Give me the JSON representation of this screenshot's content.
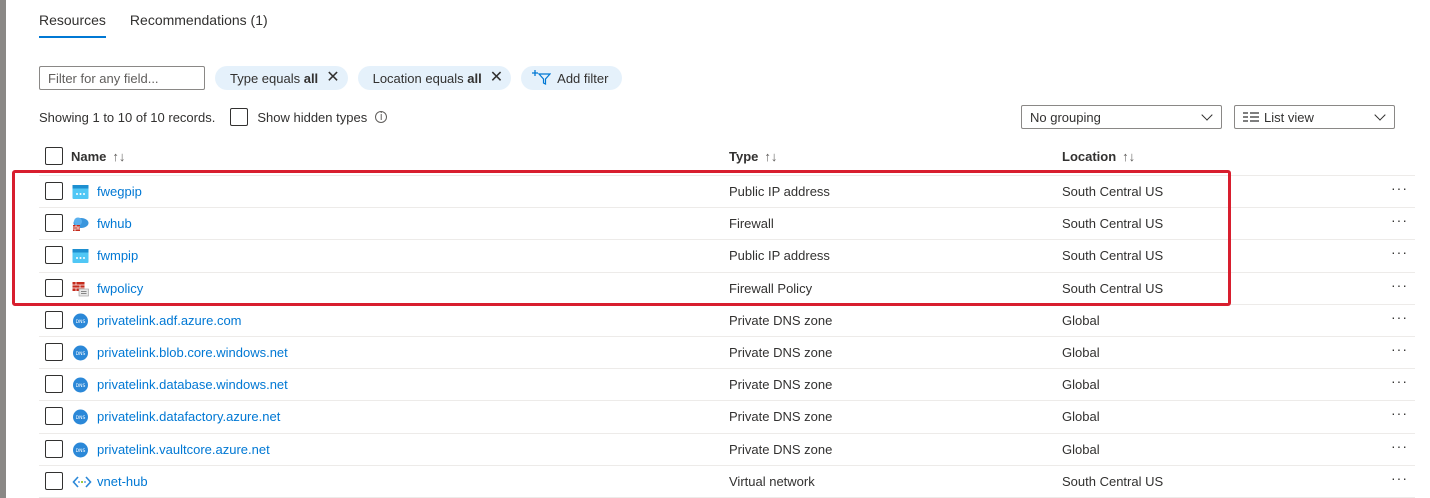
{
  "tabs": [
    {
      "label": "Resources"
    },
    {
      "label": "Recommendations (1)"
    }
  ],
  "filters": {
    "placeholder": "Filter for any field...",
    "type_pill_label": "Type equals ",
    "type_pill_value": "all",
    "location_pill_label": "Location equals ",
    "location_pill_value": "all",
    "add_filter_label": "Add filter"
  },
  "summary": {
    "records_text": "Showing 1 to 10 of 10 records.",
    "show_hidden_label": "Show hidden types"
  },
  "grouping": {
    "selected": "No grouping"
  },
  "view": {
    "selected": "List view"
  },
  "columns": {
    "name": "Name",
    "type": "Type",
    "location": "Location"
  },
  "rows": [
    {
      "name": "fwegpip",
      "type": "Public IP address",
      "location": "South Central US",
      "icon": "public-ip-icon"
    },
    {
      "name": "fwhub",
      "type": "Firewall",
      "location": "South Central US",
      "icon": "firewall-icon"
    },
    {
      "name": "fwmpip",
      "type": "Public IP address",
      "location": "South Central US",
      "icon": "public-ip-icon"
    },
    {
      "name": "fwpolicy",
      "type": "Firewall Policy",
      "location": "South Central US",
      "icon": "firewall-policy-icon"
    },
    {
      "name": "privatelink.adf.azure.com",
      "type": "Private DNS zone",
      "location": "Global",
      "icon": "dns-icon"
    },
    {
      "name": "privatelink.blob.core.windows.net",
      "type": "Private DNS zone",
      "location": "Global",
      "icon": "dns-icon"
    },
    {
      "name": "privatelink.database.windows.net",
      "type": "Private DNS zone",
      "location": "Global",
      "icon": "dns-icon"
    },
    {
      "name": "privatelink.datafactory.azure.net",
      "type": "Private DNS zone",
      "location": "Global",
      "icon": "dns-icon"
    },
    {
      "name": "privatelink.vaultcore.azure.net",
      "type": "Private DNS zone",
      "location": "Global",
      "icon": "dns-icon"
    },
    {
      "name": "vnet-hub",
      "type": "Virtual network",
      "location": "South Central US",
      "icon": "virtual-network-icon"
    }
  ],
  "more_glyph": "···",
  "colors": {
    "accent": "#0078d4",
    "highlight": "#d81e2e",
    "pill_bg": "#e5f1fb"
  }
}
